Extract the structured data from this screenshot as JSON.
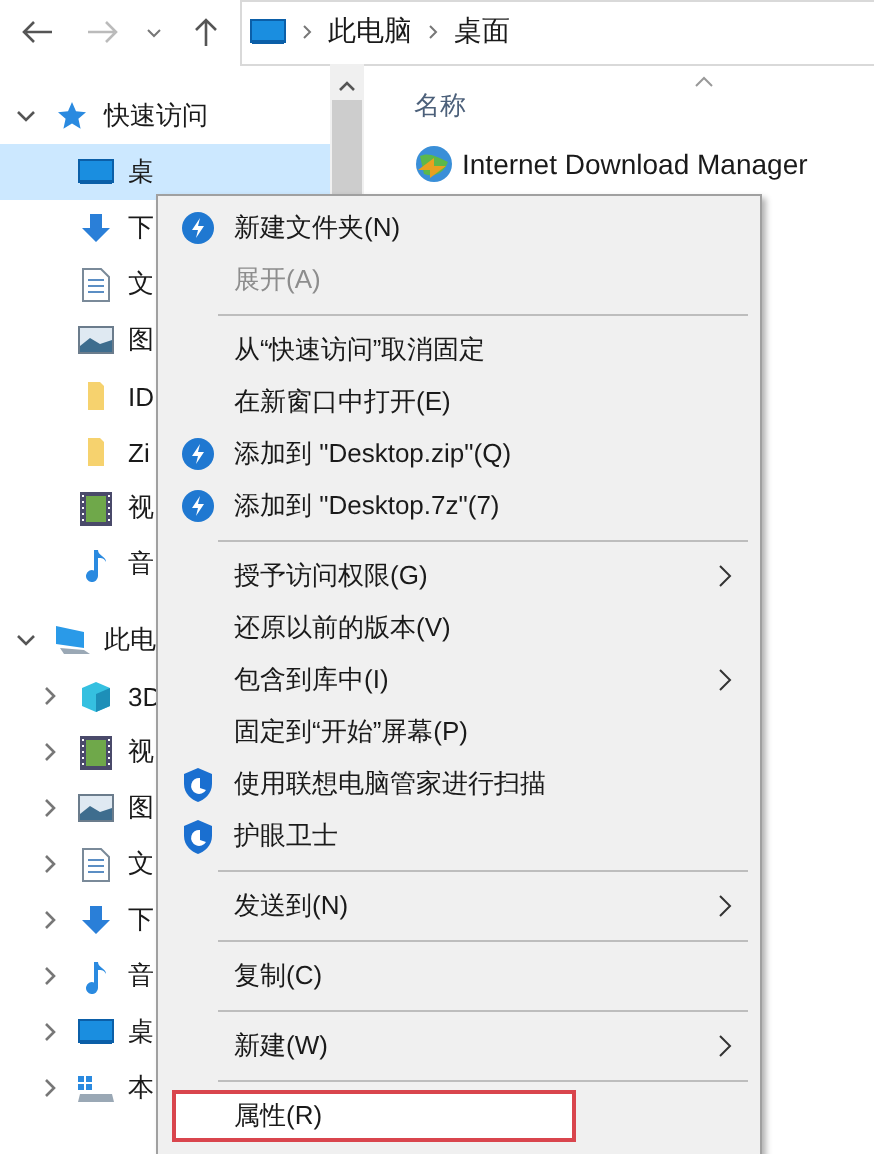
{
  "nav": {
    "back_disabled": false,
    "forward_disabled": true
  },
  "address": {
    "crumbs": [
      "此电脑",
      "桌面"
    ]
  },
  "sidebar": {
    "items": [
      {
        "label": "快速访问",
        "kind": "star",
        "expanded": true,
        "selected": false,
        "children": [
          {
            "label": "桌",
            "kind": "monitor",
            "selected": true
          },
          {
            "label": "下",
            "kind": "download",
            "selected": false
          },
          {
            "label": "文",
            "kind": "document",
            "selected": false
          },
          {
            "label": "图",
            "kind": "picture",
            "selected": false
          },
          {
            "label": "ID",
            "kind": "folder",
            "selected": false
          },
          {
            "label": "Zi",
            "kind": "folder",
            "selected": false
          },
          {
            "label": "视",
            "kind": "video",
            "selected": false
          },
          {
            "label": "音",
            "kind": "music",
            "selected": false
          }
        ]
      },
      {
        "label": "此电",
        "kind": "pc",
        "expanded": true,
        "selected": false,
        "children": [
          {
            "label": "3D",
            "kind": "cube",
            "expanded": false,
            "selected": false
          },
          {
            "label": "视",
            "kind": "video",
            "expanded": false,
            "selected": false
          },
          {
            "label": "图",
            "kind": "picture",
            "expanded": false,
            "selected": false
          },
          {
            "label": "文",
            "kind": "document",
            "expanded": false,
            "selected": false
          },
          {
            "label": "下",
            "kind": "download",
            "expanded": false,
            "selected": false
          },
          {
            "label": "音",
            "kind": "music",
            "expanded": false,
            "selected": false
          },
          {
            "label": "桌",
            "kind": "monitor",
            "expanded": false,
            "selected": false
          },
          {
            "label": "本",
            "kind": "drive",
            "expanded": false,
            "selected": false
          }
        ]
      }
    ]
  },
  "content": {
    "column": "名称",
    "files": [
      {
        "name": "Internet Download Manager",
        "kind": "globe"
      }
    ]
  },
  "context_menu": {
    "items": [
      {
        "kind": "bolt",
        "label": "新建文件夹(N)",
        "disabled": false,
        "submenu": false,
        "selected": false
      },
      {
        "kind": "item",
        "label": "展开(A)",
        "disabled": true,
        "submenu": false,
        "selected": false
      },
      {
        "kind": "separator"
      },
      {
        "kind": "item",
        "label": "从“快速访问”取消固定",
        "disabled": false,
        "submenu": false,
        "selected": false
      },
      {
        "kind": "item",
        "label": "在新窗口中打开(E)",
        "disabled": false,
        "submenu": false,
        "selected": false
      },
      {
        "kind": "bolt",
        "label": "添加到 \"Desktop.zip\"(Q)",
        "disabled": false,
        "submenu": false,
        "selected": false
      },
      {
        "kind": "bolt",
        "label": "添加到 \"Desktop.7z\"(7)",
        "disabled": false,
        "submenu": false,
        "selected": false
      },
      {
        "kind": "separator"
      },
      {
        "kind": "item",
        "label": "授予访问权限(G)",
        "disabled": false,
        "submenu": true,
        "selected": false
      },
      {
        "kind": "item",
        "label": "还原以前的版本(V)",
        "disabled": false,
        "submenu": false,
        "selected": false
      },
      {
        "kind": "item",
        "label": "包含到库中(I)",
        "disabled": false,
        "submenu": true,
        "selected": false
      },
      {
        "kind": "item",
        "label": "固定到“开始”屏幕(P)",
        "disabled": false,
        "submenu": false,
        "selected": false
      },
      {
        "kind": "shield",
        "label": "使用联想电脑管家进行扫描",
        "disabled": false,
        "submenu": false,
        "selected": false
      },
      {
        "kind": "shield",
        "label": "护眼卫士",
        "disabled": false,
        "submenu": false,
        "selected": false
      },
      {
        "kind": "separator"
      },
      {
        "kind": "item",
        "label": "发送到(N)",
        "disabled": false,
        "submenu": true,
        "selected": false
      },
      {
        "kind": "separator"
      },
      {
        "kind": "item",
        "label": "复制(C)",
        "disabled": false,
        "submenu": false,
        "selected": false
      },
      {
        "kind": "separator"
      },
      {
        "kind": "item",
        "label": "新建(W)",
        "disabled": false,
        "submenu": true,
        "selected": false
      },
      {
        "kind": "separator"
      },
      {
        "kind": "item",
        "label": "属性(R)",
        "disabled": false,
        "submenu": false,
        "selected": true
      }
    ]
  }
}
